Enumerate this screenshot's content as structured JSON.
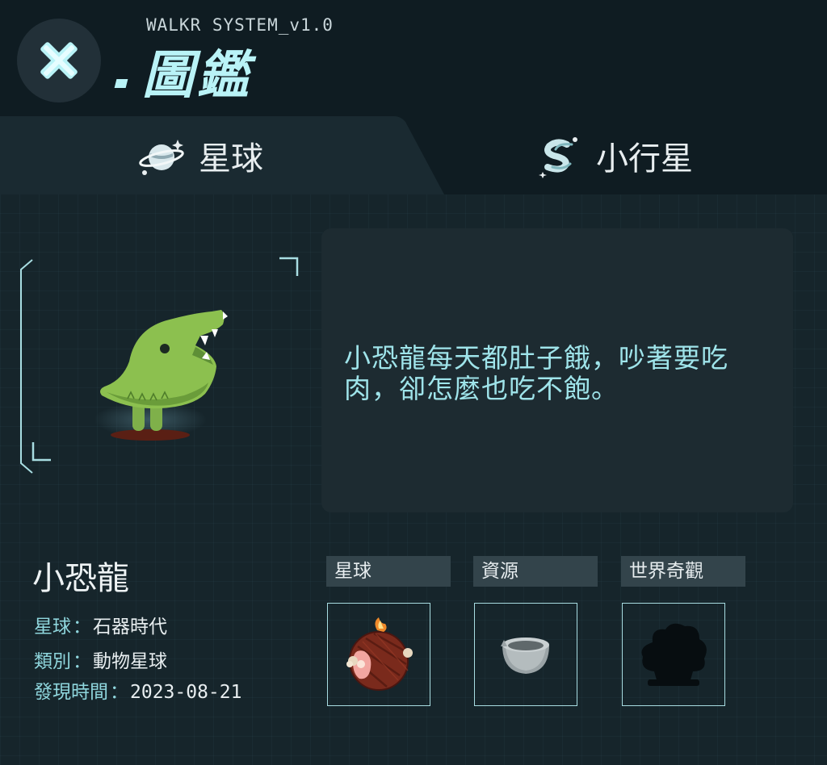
{
  "header": {
    "system_label": "WALKR SYSTEM_v1.0",
    "title": "圖鑑",
    "close_icon": "close-x-icon"
  },
  "tabs": [
    {
      "label": "星球",
      "icon": "planet-icon",
      "active": true
    },
    {
      "label": "小行星",
      "icon": "asteroid-icon",
      "active": false
    }
  ],
  "description": "小恐龍每天都肚子餓，吵著要吃肉，卻怎麼也吃不飽。",
  "creature": {
    "name": "小恐龍",
    "info": {
      "planet_label": "星球",
      "planet_value": "石器時代",
      "type_label": "類別",
      "type_value": "動物星球",
      "discovered_label": "發現時間",
      "discovered_value": "2023-08-21",
      "separator": "："
    }
  },
  "categories": [
    {
      "label": "星球",
      "item_icon": "roasted-meat-planet-icon"
    },
    {
      "label": "資源",
      "item_icon": "stone-bowl-icon"
    },
    {
      "label": "世界奇觀",
      "item_icon": "locked-wonder-silhouette-icon"
    }
  ],
  "colors": {
    "background": "#16252b",
    "header": "#0f1c22",
    "accent_cyan": "#b9f3f7",
    "description_text": "#9fe4ea",
    "info_label": "#8fd6dd",
    "creature_green": "#8cc04f"
  }
}
